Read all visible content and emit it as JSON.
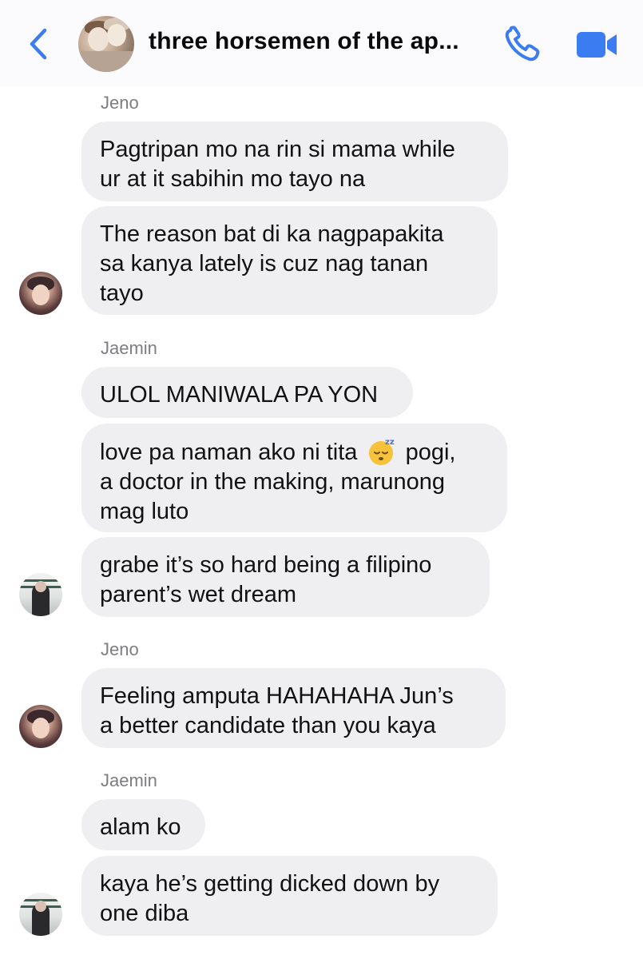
{
  "header": {
    "title": "three horsemen of the ap...",
    "back_icon": "chevron-left-icon",
    "call_icon": "phone-icon",
    "video_icon": "video-camera-icon",
    "accent_color": "#3b7cf0"
  },
  "messages": [
    {
      "sender": "Jeno",
      "lines": [
        "Pagtripan mo na rin si mama while",
        "ur at it sabihin mo tayo na"
      ]
    },
    {
      "lines": [
        "The reason bat di ka nagpapakita",
        "sa kanya lately is cuz nag tanan",
        "tayo"
      ]
    },
    {
      "sender": "Jaemin",
      "lines": [
        "ULOL MANIWALA PA YON"
      ]
    },
    {
      "lines_before_emoji": "love pa naman ako ni tita",
      "emoji": "sleeping-face-emoji",
      "lines_after_emoji": "pogi,",
      "lines": [
        "a doctor in the making, marunong",
        "mag luto"
      ]
    },
    {
      "lines": [
        "grabe it’s so hard being a filipino",
        "parent’s wet dream"
      ]
    },
    {
      "sender": "Jeno",
      "lines": [
        "Feeling amputa HAHAHAHA Jun’s",
        "a better candidate than you kaya"
      ]
    },
    {
      "sender": "Jaemin",
      "lines": [
        "alam ko"
      ]
    },
    {
      "lines": [
        "kaya he’s getting dicked down by",
        "one diba"
      ]
    }
  ],
  "colors": {
    "bubble": "#efeff1",
    "sender_label": "#7d7d82",
    "header_bg": "#fbfbfd"
  }
}
